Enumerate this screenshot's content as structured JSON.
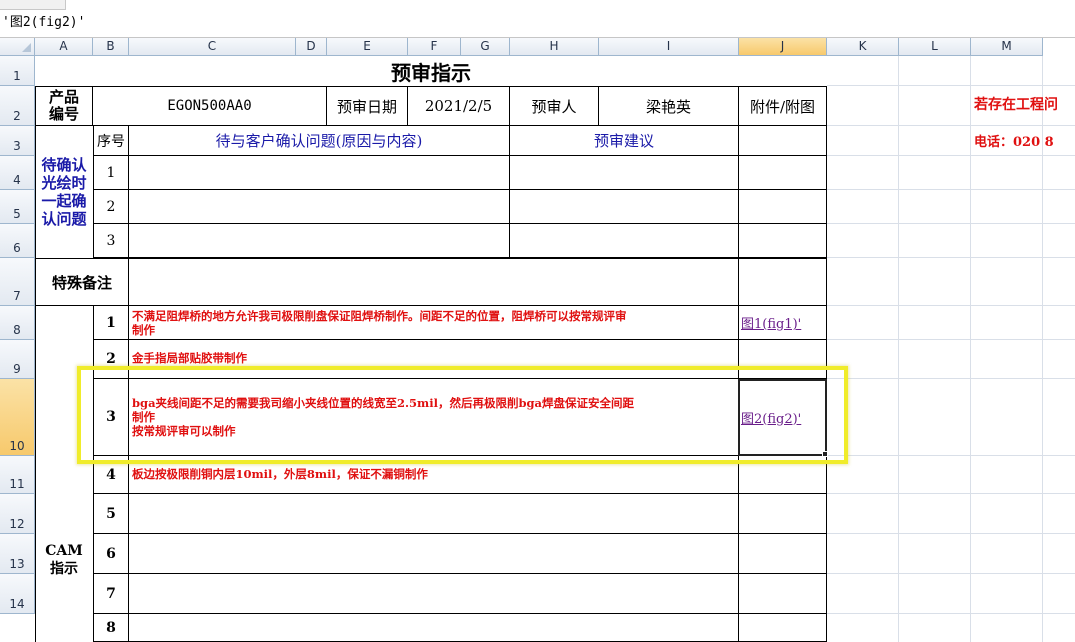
{
  "formula_bar": {
    "content": "'图2(fig2)'"
  },
  "columns": [
    "A",
    "B",
    "C",
    "D",
    "E",
    "F",
    "G",
    "H",
    "I",
    "J",
    "K",
    "L",
    "M"
  ],
  "selected_column": "J",
  "rows": [
    "1",
    "2",
    "3",
    "4",
    "5",
    "6",
    "7",
    "8",
    "9",
    "10",
    "11",
    "12",
    "13",
    "14"
  ],
  "selected_row": "10",
  "sheet": {
    "title": "预审指示",
    "product_label": "产品\n编号",
    "product_code": "EGON500AA0",
    "review_date_label": "预审日期",
    "review_date": "2021/2/5",
    "reviewer_label": "预审人",
    "reviewer": "梁艳英",
    "attachment_label": "附件/附图",
    "seq_label": "序号",
    "question_header": "待与客户确认问题(原因与内容)",
    "suggestion_header": "预审建议",
    "confirm_label": "待确认\n光绘时\n一起确\n认问题",
    "confirm_rows": [
      "1",
      "2",
      "3"
    ],
    "special_label": "特殊备注",
    "cam_label": "CAM\n指示",
    "cam_items": [
      {
        "no": "1",
        "text": "不满足阻焊桥的地方允许我司极限削盘保证阻焊桥制作。间距不足的位置，阻焊桥可以按常规评审\n制作",
        "attachment": "图1(fig1)'"
      },
      {
        "no": "2",
        "text": "金手指局部贴胶带制作",
        "attachment": ""
      },
      {
        "no": "3",
        "text": "bga夹线间距不足的需要我司缩小夹线位置的线宽至2.5mil，然后再极限削bga焊盘保证安全间距\n制作\n按常规评审可以制作",
        "attachment": "图2(fig2)'"
      },
      {
        "no": "4",
        "text": "板边按极限削铜内层10mil，外层8mil，保证不漏铜制作",
        "attachment": ""
      },
      {
        "no": "5",
        "text": "",
        "attachment": ""
      },
      {
        "no": "6",
        "text": "",
        "attachment": ""
      },
      {
        "no": "7",
        "text": "",
        "attachment": ""
      },
      {
        "no": "8",
        "text": "",
        "attachment": ""
      }
    ],
    "side_note_1": "若存在工程问",
    "side_note_2": "电话：020 8"
  },
  "colors": {
    "header_text": "#1a1aa8",
    "warning_text": "#e01010",
    "highlight_border": "#f0ec2a",
    "selected_header": "#f7c96c"
  }
}
